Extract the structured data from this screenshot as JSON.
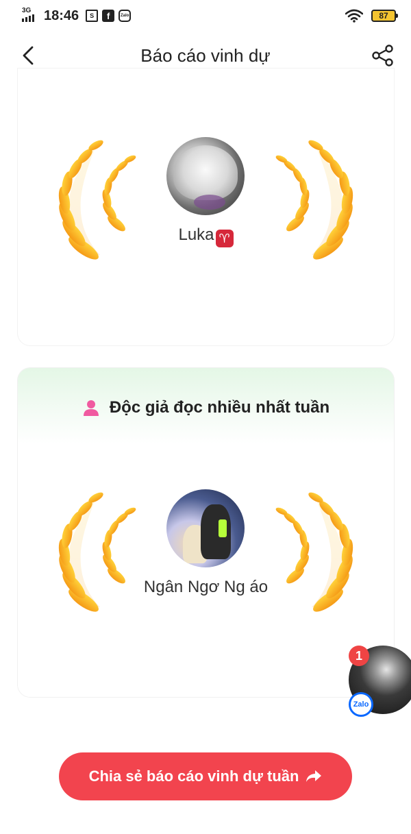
{
  "status_bar": {
    "network": "3G",
    "time": "18:46",
    "battery": "87",
    "zalo_label": "Zalo"
  },
  "header": {
    "title": "Báo cáo vinh dự"
  },
  "cards": [
    {
      "user_name": "Luka",
      "zodiac": "♈"
    },
    {
      "title": "Độc giả đọc nhiều nhất tuần",
      "user_name": "Ngân Ngơ Ng áo"
    }
  ],
  "chat_head": {
    "unread_count": "1",
    "app_label": "Zalo"
  },
  "share_button": {
    "label": "Chia sẻ báo cáo vinh dự tuần"
  },
  "colors": {
    "accent": "#f2444e",
    "laurel_gold": "#f5a623",
    "card_header_green": "#e4f7e6"
  }
}
